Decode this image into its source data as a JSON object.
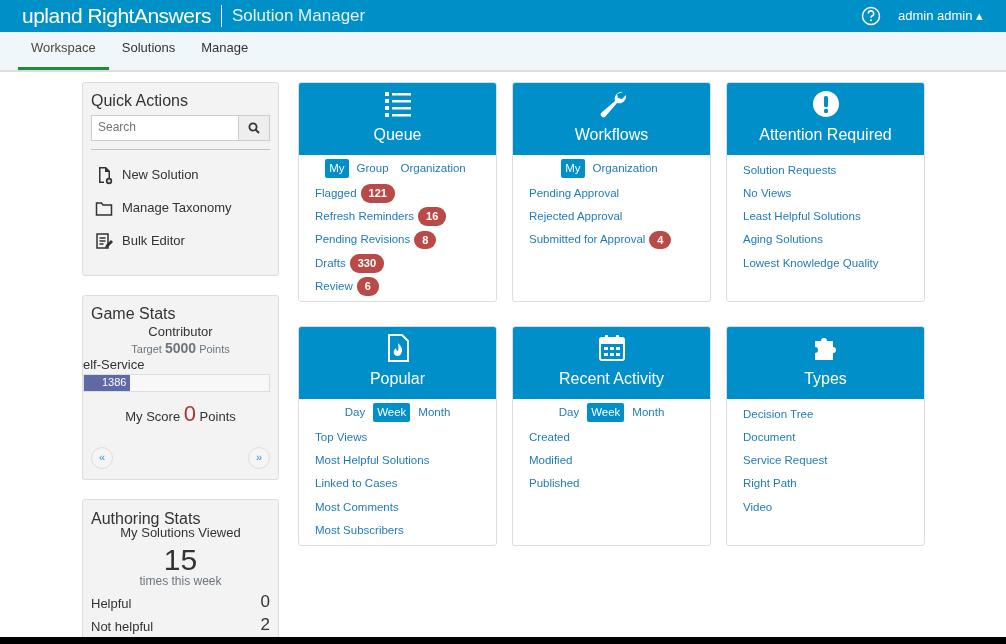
{
  "header": {
    "brand_prefix": "upland",
    "brand": "RightAnswers",
    "product": "Solution Manager",
    "user": "admin admin",
    "user_caret": "▴"
  },
  "tabs": [
    {
      "label": "Workspace",
      "selected": true
    },
    {
      "label": "Solutions",
      "selected": false
    },
    {
      "label": "Manage",
      "selected": false
    }
  ],
  "quick_actions": {
    "title": "Quick Actions",
    "search": {
      "placeholder": "Search"
    },
    "actions": [
      {
        "kind": "new-doc",
        "label": "New Solution"
      },
      {
        "kind": "folder",
        "label": "Manage Taxonomy"
      },
      {
        "kind": "bulk",
        "label": "Bulk Editor"
      }
    ]
  },
  "game_stats": {
    "title": "Game Stats",
    "rank": "Contributor",
    "target_prefix": "Target",
    "target": "5000",
    "target_suffix": "Points",
    "track_label": "elf-Service",
    "level": 0.25,
    "bar_reading": "1386",
    "score_prefix": "My Score",
    "score": "0",
    "score_suffix": "Points",
    "prev": "«",
    "next": "»"
  },
  "authoring_stats": {
    "title": "Authoring Stats",
    "subtitle": "My Solutions Viewed",
    "count": "15",
    "caption": "times this week",
    "rows": [
      {
        "label": "Helpful",
        "value": "0"
      },
      {
        "label": "Not helpful",
        "value": "2"
      }
    ]
  },
  "tiles": [
    {
      "kind": "list",
      "title": "Queue",
      "filters": [
        {
          "label": "My",
          "selected": true
        },
        {
          "label": "Group",
          "selected": false
        },
        {
          "label": "Organization",
          "selected": false
        }
      ],
      "links": [
        {
          "label": "Flagged",
          "badge": "121"
        },
        {
          "label": "Refresh Reminders",
          "badge": "16"
        },
        {
          "label": "Pending Revisions",
          "badge": "8"
        },
        {
          "label": "Drafts",
          "badge": "330"
        },
        {
          "label": "Review",
          "badge": "6"
        }
      ]
    },
    {
      "kind": "wrench",
      "title": "Workflows",
      "filters": [
        {
          "label": "My",
          "selected": true
        },
        {
          "label": "Organization",
          "selected": false
        }
      ],
      "links": [
        {
          "label": "Pending Approval"
        },
        {
          "label": "Rejected Approval"
        },
        {
          "label": "Submitted for Approval",
          "badge": "4"
        }
      ]
    },
    {
      "kind": "alert",
      "title": "Attention Required",
      "links": [
        {
          "label": "Solution Requests"
        },
        {
          "label": "No Views"
        },
        {
          "label": "Least Helpful Solutions"
        },
        {
          "label": "Aging Solutions"
        },
        {
          "label": "Lowest Knowledge Quality"
        }
      ]
    },
    {
      "kind": "flame",
      "title": "Popular",
      "filters": [
        {
          "label": "Day",
          "selected": false
        },
        {
          "label": "Week",
          "selected": true
        },
        {
          "label": "Month",
          "selected": false
        }
      ],
      "links": [
        {
          "label": "Top Views"
        },
        {
          "label": "Most Helpful Solutions"
        },
        {
          "label": "Linked to Cases"
        },
        {
          "label": "Most Comments"
        },
        {
          "label": "Most Subscribers"
        }
      ]
    },
    {
      "kind": "calendar",
      "title": "Recent Activity",
      "filters": [
        {
          "label": "Day",
          "selected": false
        },
        {
          "label": "Week",
          "selected": true
        },
        {
          "label": "Month",
          "selected": false
        }
      ],
      "links": [
        {
          "label": "Created"
        },
        {
          "label": "Modified"
        },
        {
          "label": "Published"
        }
      ]
    },
    {
      "kind": "puzzle",
      "title": "Types",
      "links": [
        {
          "label": "Decision Tree"
        },
        {
          "label": "Document"
        },
        {
          "label": "Service Request"
        },
        {
          "label": "Right Path"
        },
        {
          "label": "Video"
        }
      ]
    }
  ]
}
